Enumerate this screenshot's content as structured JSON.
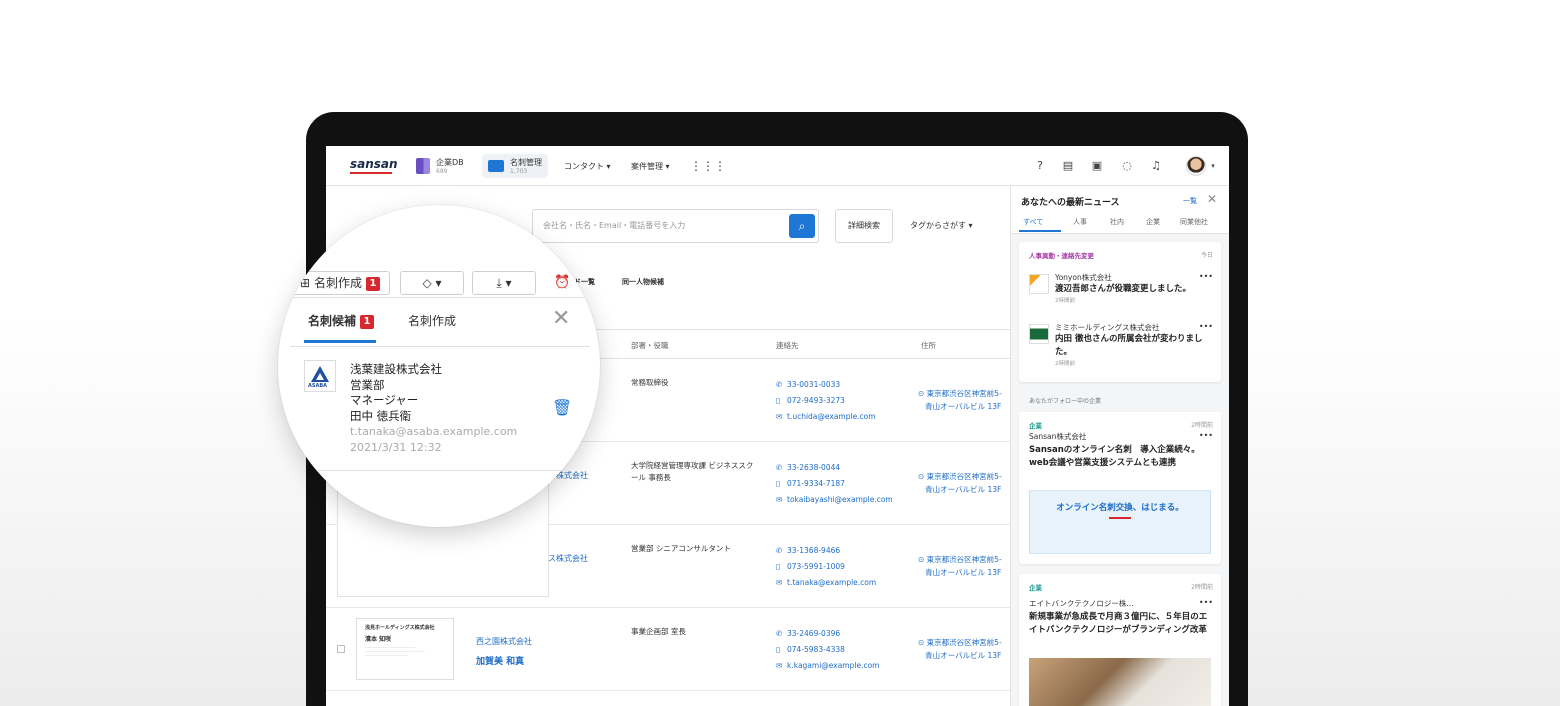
{
  "topbar": {
    "logo": "sansan",
    "nav": [
      {
        "label": "企業DB",
        "sub": "689"
      },
      {
        "label": "名刺管理",
        "sub": "1,703"
      },
      {
        "label": "コンタクト ▾"
      },
      {
        "label": "案件管理 ▾"
      }
    ],
    "icons": [
      "grid-icon",
      "help-icon",
      "card-icon",
      "contact-card-icon",
      "chat-icon",
      "bell-icon",
      "avatar"
    ]
  },
  "search": {
    "placeholder": "会社名・氏名・Email・電話番号を入力",
    "detail_label": "詳細検索",
    "tag_label": "タグからさがす ▾"
  },
  "toolbar": {
    "reminder_label": "ド一覧",
    "same_person_label": "同一人物候補"
  },
  "table": {
    "headers": [
      "部署・役職",
      "連絡先",
      "住所"
    ],
    "rows": [
      {
        "company": "",
        "person": "",
        "dept": "常務取締役",
        "phone": "33-0031-0033",
        "mobile": "072-9493-3273",
        "email": "t.uchida@example.com",
        "addr1": "東京都渋谷区神宮前5-",
        "addr2": "青山オーバルビル 13F"
      },
      {
        "company": "ズ株式会社",
        "person": "",
        "dept": "大学院経営管理専攻課 ビジネススクール 事務長",
        "phone": "33-2638-0044",
        "mobile": "071-9334-7187",
        "email": "tokaibayashi@example.com",
        "addr1": "東京都渋谷区神宮前5-",
        "addr2": "青山オーバルビル 13F"
      },
      {
        "company": "ス株式会社",
        "person": "",
        "dept": "営業部 シニアコンサルタント",
        "phone": "33-1368-9466",
        "mobile": "073-5991-1009",
        "email": "t.tanaka@example.com",
        "addr1": "東京都渋谷区神宮前5-",
        "addr2": "青山オーバルビル 13F"
      },
      {
        "company": "西之園株式会社",
        "person": "加賀美 和真",
        "dept": "事業企画部 室長",
        "phone": "33-2469-0396",
        "mobile": "074-5983-4338",
        "email": "k.kagami@example.com",
        "addr1": "東京都渋谷区神宮前5-",
        "addr2": "青山オーバルビル 13F",
        "card": {
          "company": "浅見ホールディングス株式会社",
          "name": "濱本 知咲"
        }
      }
    ]
  },
  "news": {
    "title": "あなたへの最新ニュース",
    "more": "一覧",
    "tabs": [
      "すべて",
      "人事",
      "社内",
      "企業",
      "同業他社"
    ],
    "card1": {
      "category": "人事異動・連絡先変更",
      "time": "今日",
      "items": [
        {
          "company": "Yonyon株式会社",
          "title": "渡辺吾郎さんが役職変更しました。",
          "time": "2時間前"
        },
        {
          "company": "ミミホールディングス株式会社",
          "title": "内田 徹也さんの所属会社が変わりました。",
          "time": "2時間前"
        }
      ]
    },
    "follow_label": "あなたがフォロー中の企業",
    "card2": {
      "category": "企業",
      "time": "2時間前",
      "company": "Sansan株式会社",
      "title": "Sansanのオンライン名刺　導入企業続々。web会議や営業支援システムとも連携",
      "banner": "オンライン名刺交換、はじまる。"
    },
    "card3": {
      "category": "企業",
      "time": "2時間前",
      "company": "エイトバンクテクノロジー株...",
      "title": "新規事業が急成長で月商３億円に、５年目のエイトバンクテクノロジーがブランディング改革"
    },
    "colors": {
      "hr": "#a83ca8",
      "company": "#1a9a8a"
    }
  },
  "magnifier": {
    "create_label": "名刺作成",
    "badge": "1",
    "tabs": {
      "candidates": "名刺候補",
      "create": "名刺作成",
      "badge": "1"
    },
    "card": {
      "logo_text": "ASABA",
      "company": "浅葉建設株式会社",
      "dept": "営業部",
      "title": "マネージャー",
      "name": "田中 徳兵衛",
      "email": "t.tanaka@asaba.example.com",
      "date": "2021/3/31 12:32"
    }
  },
  "colors": {
    "accent": "#1e77d4",
    "brand_red": "#d7282f"
  }
}
